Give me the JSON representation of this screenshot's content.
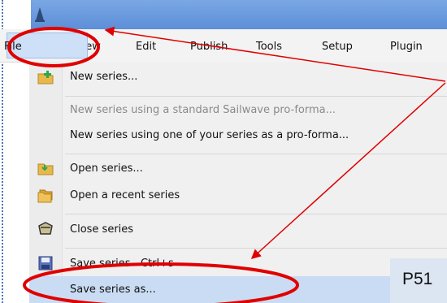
{
  "menubar": {
    "items": [
      "File",
      "View",
      "Edit",
      "Publish",
      "Tools",
      "Setup",
      "Plugin"
    ]
  },
  "file_menu": {
    "items": [
      {
        "label": "New series...",
        "icon": "new-series-icon",
        "enabled": true
      },
      {
        "label": "New series using a standard Sailwave pro-forma...",
        "enabled": false
      },
      {
        "label": "New series using one of your series as a pro-forma...",
        "enabled": true
      },
      {
        "label": "Open series...",
        "icon": "open-folder-icon",
        "enabled": true
      },
      {
        "label": "Open a recent series",
        "icon": "recent-folder-icon",
        "enabled": true
      },
      {
        "label": "Close series",
        "icon": "close-series-icon",
        "enabled": true
      },
      {
        "label": "Save series",
        "shortcut": "Ctrl+s",
        "icon": "save-disk-icon",
        "enabled": true
      },
      {
        "label": "Save series as...",
        "enabled": true,
        "highlighted": true
      }
    ]
  },
  "page_label": "P51",
  "colors": {
    "titlebar": "#6b9be0",
    "highlight": "#c9dcf3",
    "annotation": "#e00000"
  }
}
